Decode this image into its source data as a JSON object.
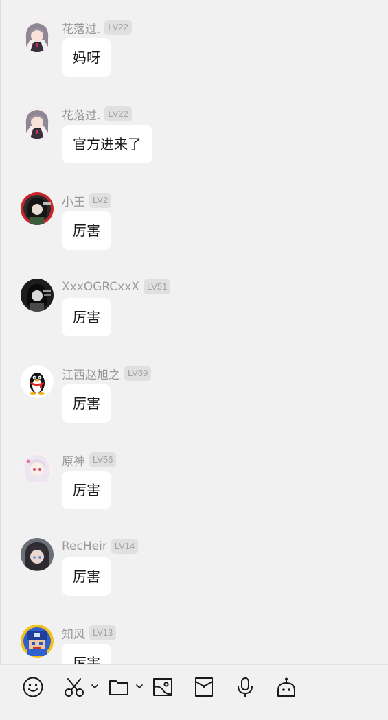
{
  "colors": {
    "background": "#f1f1f1",
    "bubble": "#ffffff",
    "name_text": "#999999",
    "level_badge_bg": "#e0e0e0",
    "icon_stroke": "#1a1a1a"
  },
  "messages": [
    {
      "name": "花落过.",
      "level": "LV22",
      "text": "妈呀",
      "avatar": "anime-gray-hair-girl"
    },
    {
      "name": "花落过.",
      "level": "LV22",
      "text": "官方进来了",
      "avatar": "anime-gray-hair-girl"
    },
    {
      "name": "小王",
      "level": "LV2",
      "text": "厉害",
      "avatar": "dark-hair-character-red-ring"
    },
    {
      "name": "XxxOGRCxxX",
      "level": "LV51",
      "text": "厉害",
      "avatar": "monochrome-character"
    },
    {
      "name": "江西赵旭之",
      "level": "LV89",
      "text": "厉害",
      "avatar": "qq-penguin"
    },
    {
      "name": "原神",
      "level": "LV56",
      "text": "厉害",
      "avatar": "anime-white-hair-girl"
    },
    {
      "name": "RecHeir",
      "level": "LV14",
      "text": "厉害",
      "avatar": "dark-hair-anime-girl"
    },
    {
      "name": "知风",
      "level": "LV13",
      "text": "厉害",
      "avatar": "pixel-blue-helmet-character"
    }
  ],
  "toolbar": {
    "tools": [
      "emoji-icon",
      "scissors-icon",
      "folder-icon",
      "image-icon",
      "red-packet-icon",
      "microphone-icon",
      "robot-icon"
    ]
  }
}
